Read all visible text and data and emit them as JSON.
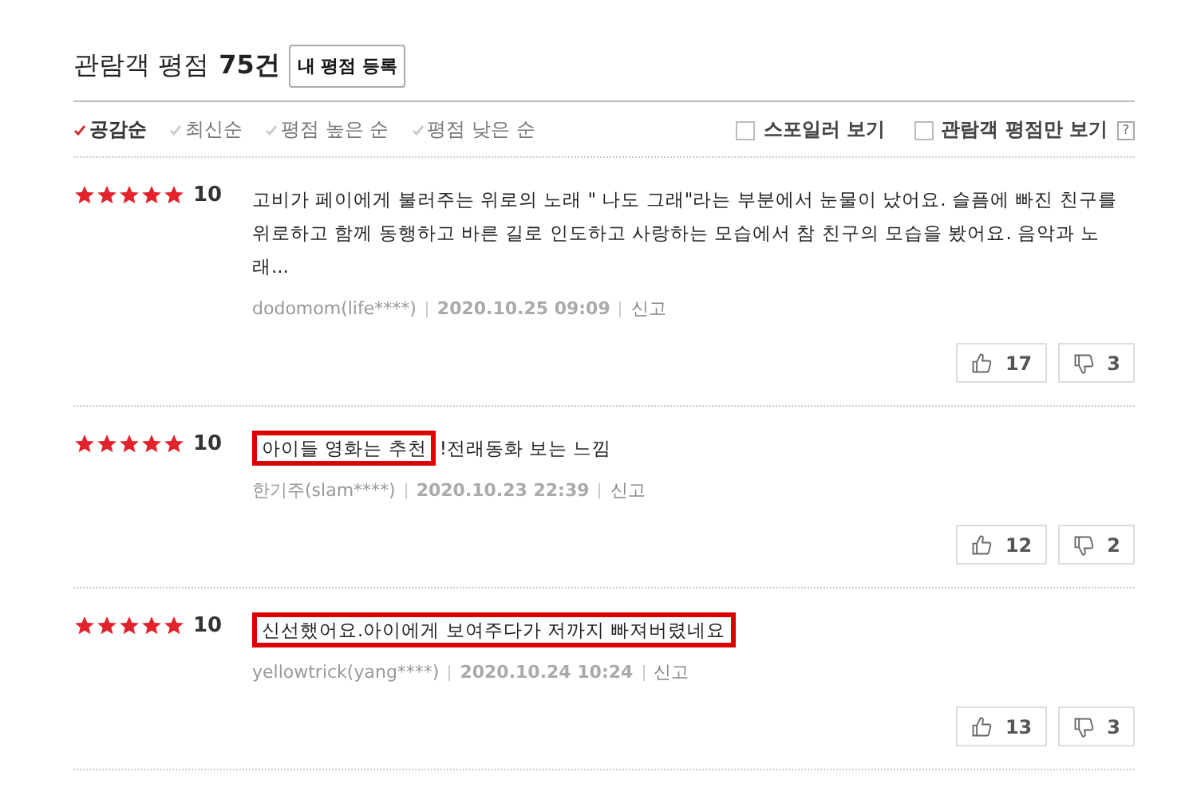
{
  "header": {
    "title": "관람객 평점",
    "count": "75건",
    "write_button": "내 평점 등록"
  },
  "sort_options": [
    {
      "label": "공감순",
      "selected": true
    },
    {
      "label": "최신순",
      "selected": false
    },
    {
      "label": "평점 높은 순",
      "selected": false
    },
    {
      "label": "평점 낮은 순",
      "selected": false
    }
  ],
  "filters": [
    {
      "label": "스포일러 보기",
      "checked": false
    },
    {
      "label": "관람객 평점만 보기",
      "checked": false
    }
  ],
  "help": "?",
  "reviews": [
    {
      "stars": 5,
      "score": "10",
      "parts": [
        {
          "text": "고비가 페이에게 불러주는 위로의 노래 \" 나도 그래\"라는 부분에서 눈물이 났어요. 슬픔에 빠진 친구를 위로하고 함께 동행하고 바른 길로 인도하고 사랑하는 모습에서 참 친구의 모습을 봤어요. 음악과 노래...",
          "highlighted": false
        }
      ],
      "author": "dodomom(life****)",
      "date": "2020.10.25 09:09",
      "report": "신고",
      "likes": "17",
      "dislikes": "3"
    },
    {
      "stars": 5,
      "score": "10",
      "parts": [
        {
          "text": "아이들 영화는 추천",
          "highlighted": true
        },
        {
          "text": "!전래동화 보는 느낌",
          "highlighted": false
        }
      ],
      "author": "한기주(slam****)",
      "date": "2020.10.23 22:39",
      "report": "신고",
      "likes": "12",
      "dislikes": "2"
    },
    {
      "stars": 5,
      "score": "10",
      "parts": [
        {
          "text": "신선했어요.아이에게 보여주다가 저까지 빠져버렸네요",
          "highlighted": true
        }
      ],
      "author": "yellowtrick(yang****)",
      "date": "2020.10.24 10:24",
      "report": "신고",
      "likes": "13",
      "dislikes": "3"
    }
  ]
}
